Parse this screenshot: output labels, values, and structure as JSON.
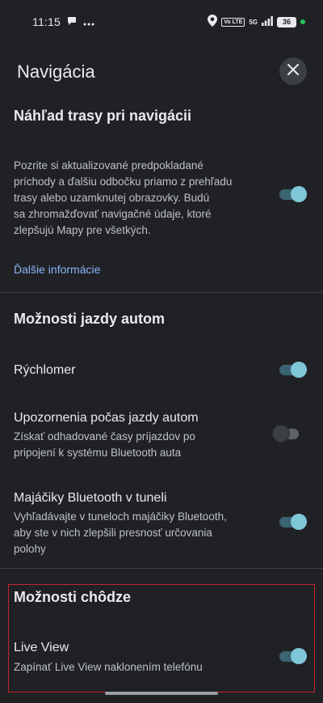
{
  "status_bar": {
    "time": "11:15",
    "volte": "Vo LTE",
    "network": "5G",
    "battery": "36"
  },
  "header": {
    "title": "Navigácia"
  },
  "route_preview": {
    "title": "Náhľad trasy pri navigácii",
    "description_lines": [
      "Pozrite si aktualizované predpokladané",
      "príchody a ďalšiu odbočku priamo z prehľadu",
      "trasy alebo uzamknutej obrazovky. Budú",
      "sa zhromažďovať navigačné údaje, ktoré",
      "zlepšujú Mapy pre všetkých."
    ],
    "toggle_on": true,
    "more_info": "Ďalšie informácie"
  },
  "driving": {
    "title": "Možnosti jazdy autom",
    "items": [
      {
        "title": "Rýchlomer",
        "toggle_on": true
      },
      {
        "title": "Upozornenia počas jazdy autom",
        "lines": [
          "Získať odhadované časy príjazdov po",
          "pripojení k systému Bluetooth auta"
        ],
        "toggle_on": false
      },
      {
        "title": "Majáčiky Bluetooth v tuneli",
        "lines": [
          "Vyhľadávajte v tuneloch majáčiky Bluetooth,",
          "aby ste v nich zlepšili presnosť určovania",
          "polohy"
        ],
        "toggle_on": true
      }
    ]
  },
  "walking": {
    "title": "Možnosti chôdze",
    "items": [
      {
        "title": "Live View",
        "lines": [
          "Zapínať Live View naklonením telefónu"
        ],
        "toggle_on": true
      }
    ]
  },
  "colors": {
    "background": "#202124",
    "accent_thumb": "#7fc6d9",
    "accent_track": "#3a6470",
    "link": "#8ab4f8",
    "highlight_border": "#c4252b"
  }
}
